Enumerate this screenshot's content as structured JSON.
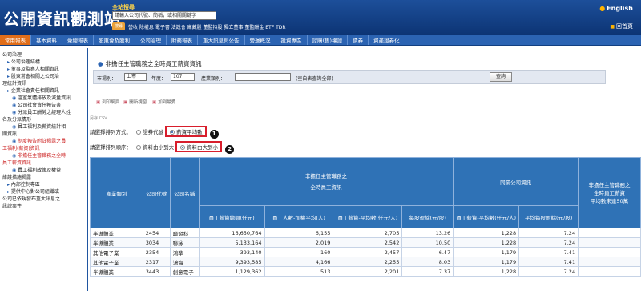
{
  "header": {
    "logo": "公開資訊觀測站",
    "search_title": "全站搜尋",
    "search_placeholder": "請輸入公司代號、簡稱，或相關關鍵字",
    "search_button": "搜尋",
    "popular": "營收 除權息 電子書 法說會 庫藏股 董監持股 獨立董事 董監酬金 ETF TDR",
    "english": "English",
    "home": "回首頁"
  },
  "nav": {
    "items": [
      "常用報表",
      "基本資料",
      "彙總報表",
      "股東會及股利",
      "公司治理",
      "財務報表",
      "重大訊息與公告",
      "營運概況",
      "投資專區",
      "認購(售)權證",
      "債券",
      "資產證券化"
    ],
    "active_index": 0
  },
  "sidebar": {
    "items": [
      {
        "text": "公司治理",
        "level": 1
      },
      {
        "text": "公司治理結構",
        "level": 2
      },
      {
        "text": "董事及監察人相關資訊",
        "level": 2
      },
      {
        "text": "股東常會相關之公司治",
        "level": 2
      },
      {
        "text": "理統計資訊",
        "level": 1
      },
      {
        "text": "企業社會責任相關資訊",
        "level": 2
      },
      {
        "text": "溫室氣體排放及減量資訊",
        "level": 3
      },
      {
        "text": "公司社會責任報告書",
        "level": 3
      },
      {
        "text": "分派員工酬勞之經理人姓",
        "level": 3
      },
      {
        "text": "名及分派情形",
        "level": 1
      },
      {
        "text": "員工福利及薪資統計相",
        "level": 3
      },
      {
        "text": "關資訊",
        "level": 1
      },
      {
        "text": "制度報告附註揭露之員",
        "level": 3,
        "red": true
      },
      {
        "text": "工福利(薪資)資訊",
        "level": 1,
        "red": true
      },
      {
        "text": "非擔任主管職務之全時",
        "level": 3,
        "red": true
      },
      {
        "text": "員工薪資資訊",
        "level": 1,
        "red": true
      },
      {
        "text": "員工福利政策及權益",
        "level": 3
      },
      {
        "text": "維護措施揭露",
        "level": 1
      },
      {
        "text": "內部控制專區",
        "level": 2
      },
      {
        "text": "提供中心對公司組織或",
        "level": 2
      },
      {
        "text": "公司已依規發布重大訊息之",
        "level": 1
      },
      {
        "text": "訊說案件",
        "level": 1
      }
    ]
  },
  "main": {
    "title": "非擔任主管職務之全時員工薪資資訊",
    "filters": {
      "market_label": "市場別：",
      "market_value": "上市",
      "year_label": "年度：",
      "year_value": "107",
      "industry_label": "產業類別：",
      "industry_value": "",
      "industry_hint": "(空白表查詢全部)",
      "query_button": "查詢"
    },
    "tools": [
      "列印網頁",
      "開新視窗",
      "加到最愛"
    ],
    "print_link": "另存 CSV",
    "sort_method_label": "請選擇排列方式：",
    "sort_by_code": "證券代號",
    "sort_by_salary": "薪資平均數",
    "sort_order_label": "請選擇排列順序：",
    "order_asc": "資料由小到大",
    "order_desc": "資料由大到小",
    "marker1": "1",
    "marker2": "2"
  },
  "table": {
    "group_nonmgr_line1": "非擔任主管職務之",
    "group_nonmgr_line2": "全時員工資訊",
    "group_peer": "同業公司資訊",
    "group_right_line1": "非擔任主管職務之",
    "group_right_line2": "全時員工薪資",
    "group_right_line3": "平均數未達50萬",
    "col_industry": "產業類別",
    "col_code": "公司代號",
    "col_name": "公司名稱",
    "sub_cols": [
      "員工薪資總額(仟元)",
      "員工人數-加權平均(人)",
      "員工薪資-平均數(仟元/人)",
      "每股盈餘(元/股)",
      "員工薪資-平均數(仟元/人)",
      "平均每股盈餘(元/股)"
    ],
    "rows": [
      {
        "industry": "半導體業",
        "code": "2454",
        "name": "聯發科",
        "total": "16,650,764",
        "count": "6,155",
        "avg": "2,705",
        "eps": "13.26",
        "peer_avg": "1,228",
        "peer_eps": "7.24"
      },
      {
        "industry": "半導體業",
        "code": "3034",
        "name": "聯詠",
        "total": "5,133,164",
        "count": "2,019",
        "avg": "2,542",
        "eps": "10.50",
        "peer_avg": "1,228",
        "peer_eps": "7.24"
      },
      {
        "industry": "其他電子業",
        "code": "2354",
        "name": "鴻準",
        "total": "393,140",
        "count": "160",
        "avg": "2,457",
        "eps": "6.47",
        "peer_avg": "1,179",
        "peer_eps": "7.41"
      },
      {
        "industry": "其他電子業",
        "code": "2317",
        "name": "鴻海",
        "total": "9,393,585",
        "count": "4,166",
        "avg": "2,255",
        "eps": "8.03",
        "peer_avg": "1,179",
        "peer_eps": "7.41"
      },
      {
        "industry": "半導體業",
        "code": "3443",
        "name": "創意電子",
        "total": "1,129,362",
        "count": "513",
        "avg": "2,201",
        "eps": "7.37",
        "peer_avg": "1,228",
        "peer_eps": "7.24"
      }
    ]
  }
}
